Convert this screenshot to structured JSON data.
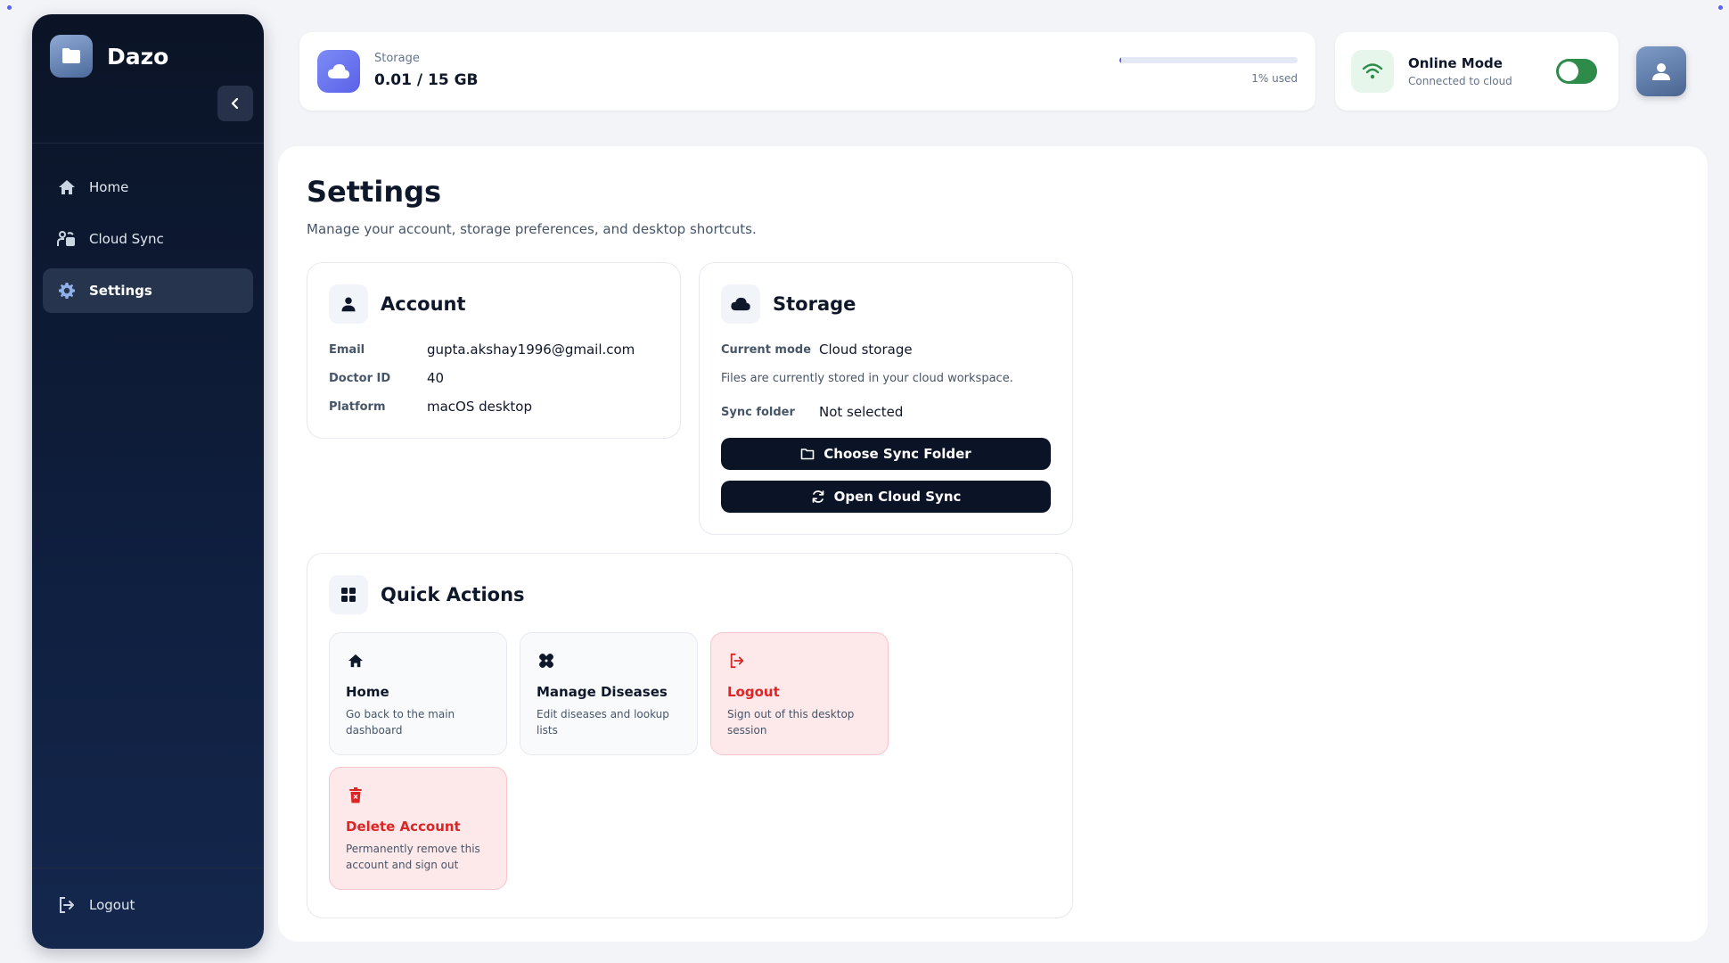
{
  "sidebar": {
    "brand": "Dazo",
    "items": [
      {
        "label": "Home",
        "icon": "home-icon"
      },
      {
        "label": "Cloud Sync",
        "icon": "cloud-sync-icon"
      },
      {
        "label": "Settings",
        "icon": "gear-icon"
      }
    ],
    "logout_label": "Logout"
  },
  "topbar": {
    "storage_label": "Storage",
    "storage_value": "0.01 / 15 GB",
    "storage_used_fraction": 0.01,
    "storage_used_text": "1% used",
    "online_title": "Online Mode",
    "online_subtitle": "Connected to cloud",
    "online_enabled": true
  },
  "page": {
    "title": "Settings",
    "subtitle": "Manage your account, storage preferences, and desktop shortcuts."
  },
  "account": {
    "title": "Account",
    "rows": [
      {
        "label": "Email",
        "value": "gupta.akshay1996@gmail.com"
      },
      {
        "label": "Doctor ID",
        "value": "40"
      },
      {
        "label": "Platform",
        "value": "macOS desktop"
      }
    ]
  },
  "storage": {
    "title": "Storage",
    "current_mode_label": "Current mode",
    "current_mode_value": "Cloud storage",
    "note": "Files are currently stored in your cloud workspace.",
    "sync_folder_label": "Sync folder",
    "sync_folder_value": "Not selected",
    "choose_button": "Choose Sync Folder",
    "open_button": "Open Cloud Sync"
  },
  "quick_actions": {
    "title": "Quick Actions",
    "tiles": [
      {
        "title": "Home",
        "desc": "Go back to the main dashboard",
        "danger": false,
        "icon": "home-icon"
      },
      {
        "title": "Manage Diseases",
        "desc": "Edit diseases and lookup lists",
        "danger": false,
        "icon": "bandage-icon"
      },
      {
        "title": "Logout",
        "desc": "Sign out of this desktop session",
        "danger": true,
        "icon": "logout-icon"
      },
      {
        "title": "Delete Account",
        "desc": "Permanently remove this account and sign out",
        "danger": true,
        "icon": "trash-icon"
      }
    ]
  },
  "colors": {
    "accent": "#5b61e8",
    "sidebar_bg": "#0b1426",
    "success": "#2e8b4a",
    "danger": "#dc2626"
  }
}
